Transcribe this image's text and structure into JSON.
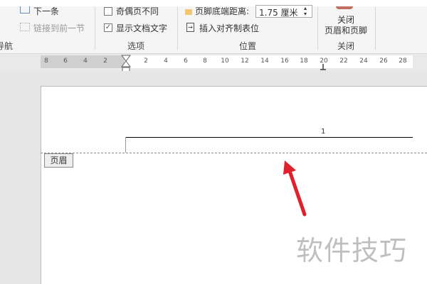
{
  "ribbon": {
    "nav": {
      "next": "下一条",
      "link_prev": "链接到前一节",
      "group": "导航"
    },
    "options": {
      "diff_odd_even": "奇偶页不同",
      "show_doc_text": "显示文档文字",
      "show_doc_text_checked": true,
      "group": "选项"
    },
    "position": {
      "footer_bottom_label": "页脚底端距离:",
      "footer_bottom_value": "1.75 厘米",
      "insert_tab": "插入对齐制表位",
      "group": "位置"
    },
    "close": {
      "button_line1": "关闭",
      "button_line2": "页眉和页脚",
      "group": "关闭"
    }
  },
  "ruler": {
    "left_ticks": [
      "8",
      "6",
      "4",
      "2"
    ],
    "right_ticks": [
      "2",
      "4",
      "6",
      "8",
      "10",
      "12",
      "14",
      "16",
      "18",
      "20",
      "22",
      "24",
      "26",
      "28"
    ]
  },
  "document": {
    "page_number": "1",
    "header_tag": "页眉"
  },
  "watermark": "软件技巧",
  "colors": {
    "arrow": "#e0202a"
  }
}
